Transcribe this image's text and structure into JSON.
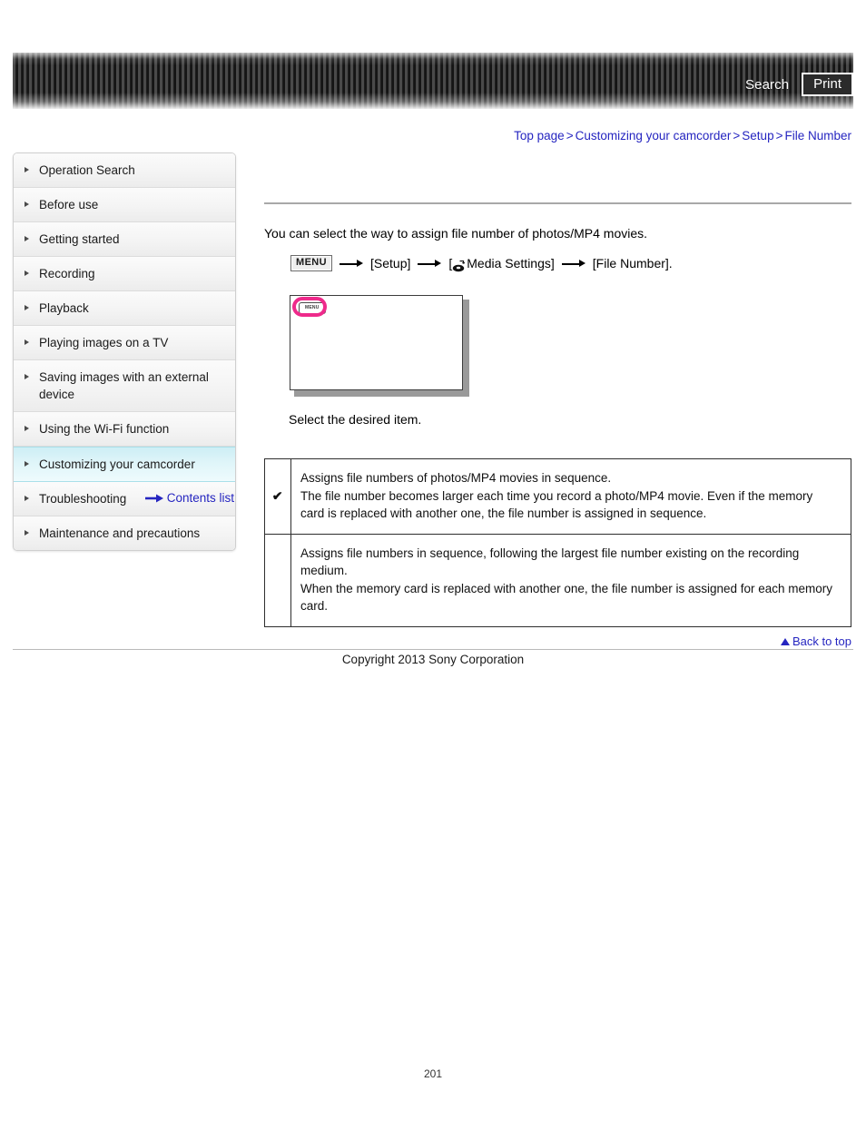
{
  "header": {
    "search_label": "Search",
    "print_label": "Print",
    "search_icon": "search-icon",
    "print_icon": "print-icon"
  },
  "breadcrumb": {
    "separator": ">",
    "items": [
      {
        "label": "Top page"
      },
      {
        "label": "Customizing your camcorder"
      },
      {
        "label": "Setup"
      },
      {
        "label": "File Number"
      }
    ]
  },
  "sidebar": {
    "items": [
      {
        "label": "Operation Search",
        "active": false
      },
      {
        "label": "Before use",
        "active": false
      },
      {
        "label": "Getting started",
        "active": false
      },
      {
        "label": "Recording",
        "active": false
      },
      {
        "label": "Playback",
        "active": false
      },
      {
        "label": "Playing images on a TV",
        "active": false
      },
      {
        "label": "Saving images with an external device",
        "active": false
      },
      {
        "label": "Using the Wi-Fi function",
        "active": false
      },
      {
        "label": "Customizing your camcorder",
        "active": true
      },
      {
        "label": "Troubleshooting",
        "active": false
      },
      {
        "label": "Maintenance and precautions",
        "active": false
      }
    ],
    "contents_list_label": "Contents list",
    "contents_list_icon": "right-arrow-icon",
    "bullet_icon": "triangle-right-icon",
    "highlight_color": "#cdeef5"
  },
  "main": {
    "intro": "You can select the way to assign file number of photos/MP4 movies.",
    "menu_path": {
      "menu_button_label": "MENU",
      "media_icon": "media-settings-icon",
      "step_setup": "[Setup]",
      "step_media": "Media Settings]",
      "step_media_prefix": "[",
      "step_file_number": "[File Number].",
      "arrow_icon": "arrow-right-icon"
    },
    "screen_mock": {
      "menu_button_label": "MENU",
      "highlight_color": "#ee2a8b",
      "highlight_icon": "pink-highlight-ring"
    },
    "select_caption": "Select the desired item.",
    "options": [
      {
        "selected_mark": "✔",
        "is_selected": true,
        "lines": [
          "Assigns file numbers of photos/MP4 movies in sequence.",
          "The file number becomes larger each time you record a photo/MP4 movie. Even if the memory card is replaced with another one, the file number is assigned in sequence."
        ]
      },
      {
        "selected_mark": "",
        "is_selected": false,
        "lines": [
          "Assigns file numbers in sequence, following the largest file number existing on the recording medium.",
          "When the memory card is replaced with another one, the file number is assigned for each memory card."
        ]
      }
    ]
  },
  "footer": {
    "back_to_top_label": "Back to top",
    "back_to_top_icon": "triangle-up-icon",
    "copyright": "Copyright 2013 Sony Corporation",
    "page_number": "201"
  },
  "colors": {
    "link": "#2525c0",
    "highlight_pink": "#ee2a8b",
    "sidebar_active": "#cdeef5"
  }
}
